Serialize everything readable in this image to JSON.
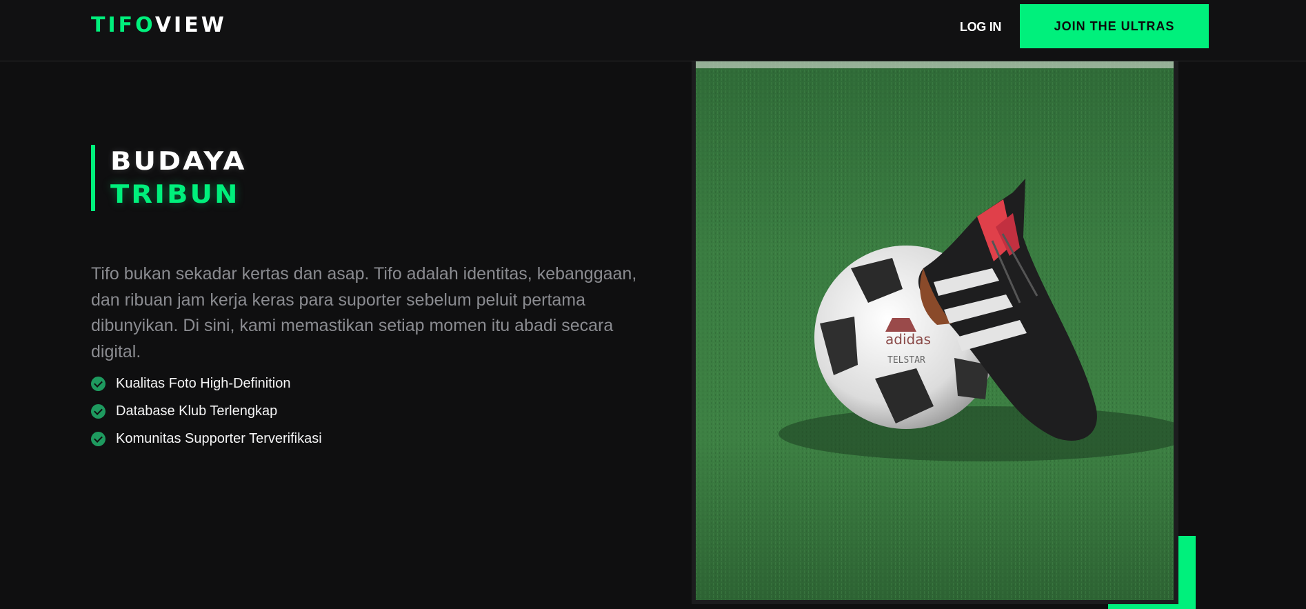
{
  "nav": {
    "logo_part1": "TIFO",
    "logo_part2": "VIEW",
    "login_label": "LOG IN",
    "cta_label": "JOIN THE ULTRAS"
  },
  "hero": {
    "title_line1": "BUDAYA",
    "title_line2": "TRIBUN",
    "description": "Tifo bukan sekadar kertas dan asap. Tifo adalah identitas, kebanggaan, dan ribuan jam kerja keras para suporter sebelum peluit pertama dibunyikan. Di sini, kami memastikan setiap momen itu abadi secara digital.",
    "features": [
      "Kualitas Foto High-Definition",
      "Database Klub Terlengkap",
      "Komunitas Supporter Terverifikasi"
    ],
    "ball_brand": "adidas",
    "ball_model": "TELSTAR"
  },
  "colors": {
    "accent": "#00f07c",
    "background": "#0f0f10",
    "text_muted": "#8a8b90"
  }
}
